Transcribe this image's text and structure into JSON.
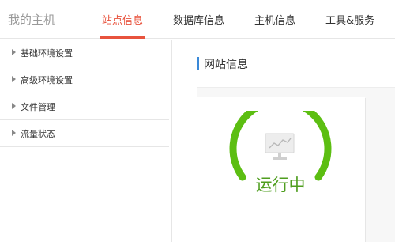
{
  "header": {
    "brand": "我的主机",
    "tabs": [
      {
        "label": "站点信息",
        "active": true
      },
      {
        "label": "数据库信息",
        "active": false
      },
      {
        "label": "主机信息",
        "active": false
      },
      {
        "label": "工具&服务",
        "active": false
      }
    ]
  },
  "sidebar": {
    "items": [
      {
        "label": "基础环境设置"
      },
      {
        "label": "高级环境设置"
      },
      {
        "label": "文件管理"
      },
      {
        "label": "流量状态"
      }
    ]
  },
  "main": {
    "section_title": "网站信息",
    "status": {
      "text": "运行中",
      "icon": "monitor-icon",
      "color": "#5cbe12"
    }
  },
  "colors": {
    "accent": "#e8533d",
    "title_bar": "#3a89d8",
    "status_green": "#5cbe12"
  }
}
